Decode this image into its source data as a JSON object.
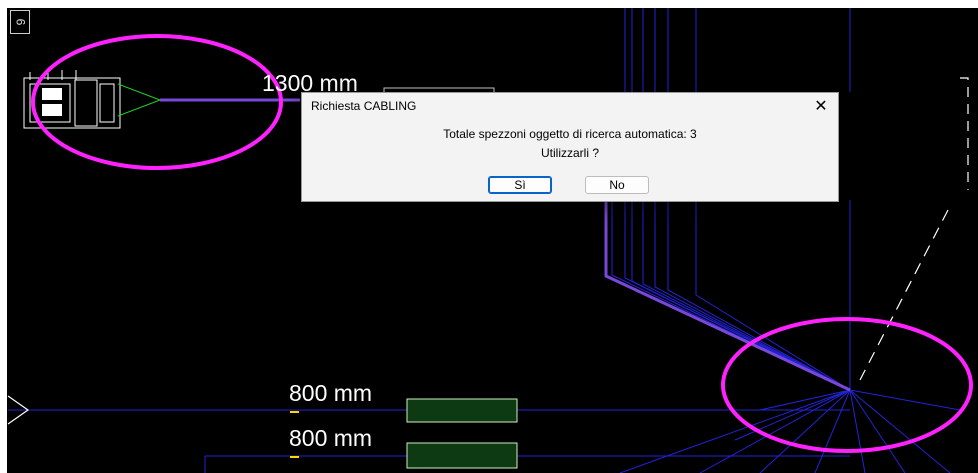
{
  "cad": {
    "sheet_number": "6",
    "dimension_top": "1300 mm",
    "dimension_mid": "800 mm",
    "dimension_bottom": "800 mm",
    "background_color": "#000000",
    "wire_color": "#2a2aff",
    "bundle_color": "#7a48d8",
    "highlight_color": "#ff22ff"
  },
  "dialog": {
    "title": "Richiesta CABLING",
    "message_line1": "Totale spezzoni oggetto di ricerca automatica: 3",
    "message_line2": "Utilizzarli ?",
    "yes_label": "Sì",
    "no_label": "No",
    "close_icon": "close-icon"
  }
}
